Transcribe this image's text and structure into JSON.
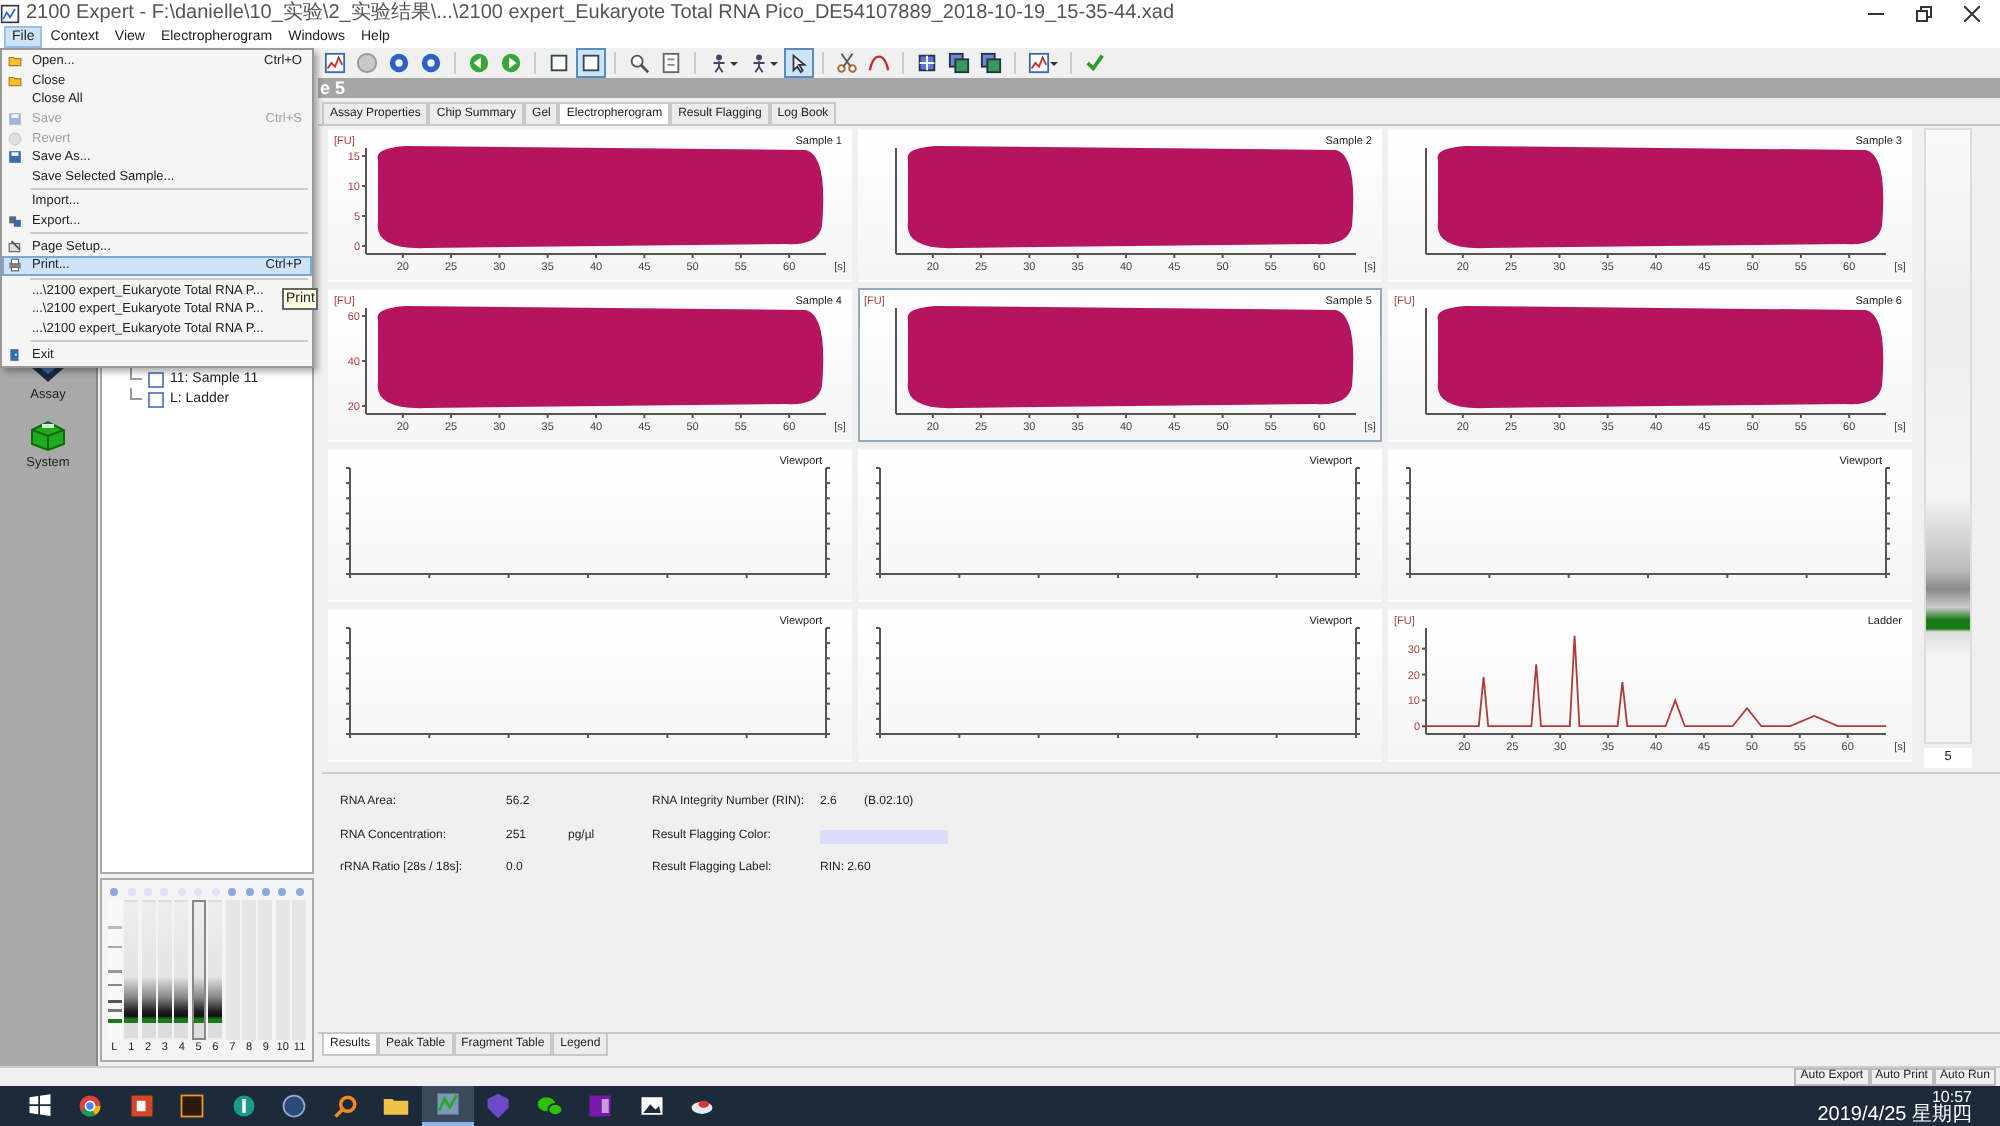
{
  "window": {
    "title": "2100 Expert - F:\\danielle\\10_实验\\2_实验结果\\...\\2100 expert_Eukaryote Total RNA Pico_DE54107889_2018-10-19_15-35-44.xad"
  },
  "menu_bar": [
    {
      "label": "File",
      "selected": true
    },
    {
      "label": "Context",
      "selected": false
    },
    {
      "label": "View",
      "selected": false
    },
    {
      "label": "Electropherogram",
      "selected": false
    },
    {
      "label": "Windows",
      "selected": false
    },
    {
      "label": "Help",
      "selected": false
    }
  ],
  "file_menu": {
    "items": [
      {
        "kind": "item",
        "label": "Open...",
        "shortcut": "Ctrl+O",
        "disabled": false,
        "selected": false
      },
      {
        "kind": "item",
        "label": "Close",
        "disabled": false,
        "selected": false
      },
      {
        "kind": "item",
        "label": "Close All",
        "disabled": false,
        "selected": false
      },
      {
        "kind": "item",
        "label": "Save",
        "shortcut": "Ctrl+S",
        "disabled": true,
        "selected": false
      },
      {
        "kind": "item",
        "label": "Revert",
        "disabled": true,
        "selected": false
      },
      {
        "kind": "item",
        "label": "Save As...",
        "disabled": false,
        "selected": false
      },
      {
        "kind": "item",
        "label": "Save Selected Sample...",
        "disabled": false,
        "selected": false
      },
      {
        "kind": "separator"
      },
      {
        "kind": "item",
        "label": "Import...",
        "disabled": false,
        "selected": false
      },
      {
        "kind": "item",
        "label": "Export...",
        "disabled": false,
        "selected": false
      },
      {
        "kind": "separator"
      },
      {
        "kind": "item",
        "label": "Page Setup...",
        "disabled": false,
        "selected": false
      },
      {
        "kind": "item",
        "label": "Print...",
        "shortcut": "Ctrl+P",
        "disabled": false,
        "selected": true
      },
      {
        "kind": "separator"
      },
      {
        "kind": "item",
        "label": "...\\2100 expert_Eukaryote Total RNA P...",
        "disabled": false,
        "selected": false
      },
      {
        "kind": "item",
        "label": "...\\2100 expert_Eukaryote Total RNA P...",
        "disabled": false,
        "selected": false
      },
      {
        "kind": "item",
        "label": "...\\2100 expert_Eukaryote Total RNA P...",
        "disabled": false,
        "selected": false
      },
      {
        "kind": "separator"
      },
      {
        "kind": "item",
        "label": "Exit",
        "disabled": false,
        "selected": false
      }
    ],
    "tooltip": "Print"
  },
  "toolbar": [
    {
      "kind": "chart",
      "selected": false
    },
    {
      "kind": "graydisc",
      "selected": false
    },
    {
      "kind": "bluedisc",
      "selected": false
    },
    {
      "kind": "bluedisc",
      "selected": false
    },
    {
      "kind": "back",
      "selected": false
    },
    {
      "kind": "forward",
      "selected": false
    },
    {
      "kind": "frame",
      "selected": false
    },
    {
      "kind": "frame",
      "selected": true
    },
    {
      "kind": "magnifier",
      "selected": false
    },
    {
      "kind": "page",
      "selected": false
    },
    {
      "kind": "figure",
      "selected": false,
      "caret": true
    },
    {
      "kind": "figure",
      "selected": false,
      "caret": true
    },
    {
      "kind": "pointer",
      "selected": true
    },
    {
      "kind": "scissors",
      "selected": false
    },
    {
      "kind": "curve",
      "selected": false
    },
    {
      "kind": "grid",
      "selected": false
    },
    {
      "kind": "image",
      "selected": false
    },
    {
      "kind": "image",
      "selected": false
    },
    {
      "kind": "chart",
      "selected": false,
      "caret": true
    },
    {
      "kind": "check",
      "selected": false
    }
  ],
  "nav": [
    {
      "label": "Assay",
      "kind": "assay"
    },
    {
      "label": "System",
      "kind": "system"
    }
  ],
  "tree": [
    {
      "label": "11: Sample 11",
      "checked": false
    },
    {
      "label": "L: Ladder",
      "checked": false
    }
  ],
  "gel": {
    "lanes": [
      {
        "label": "L",
        "kind": "ladder",
        "selected": false
      },
      {
        "label": "1",
        "kind": "sample",
        "selected": false
      },
      {
        "label": "2",
        "kind": "sample",
        "selected": false
      },
      {
        "label": "3",
        "kind": "sample",
        "selected": false
      },
      {
        "label": "4",
        "kind": "sample",
        "selected": false
      },
      {
        "label": "5",
        "kind": "sample",
        "selected": true
      },
      {
        "label": "6",
        "kind": "sample",
        "selected": false
      },
      {
        "label": "7",
        "kind": "empty",
        "selected": false
      },
      {
        "label": "8",
        "kind": "empty",
        "selected": false
      },
      {
        "label": "9",
        "kind": "empty",
        "selected": false
      },
      {
        "label": "10",
        "kind": "empty",
        "selected": false
      },
      {
        "label": "11",
        "kind": "empty",
        "selected": false
      }
    ]
  },
  "header": "e 5",
  "tabs": [
    {
      "label": "Assay Properties",
      "selected": false
    },
    {
      "label": "Chip Summary",
      "selected": false
    },
    {
      "label": "Gel",
      "selected": false
    },
    {
      "label": "Electropherogram",
      "selected": true
    },
    {
      "label": "Result Flagging",
      "selected": false
    },
    {
      "label": "Log Book",
      "selected": false
    }
  ],
  "charts": [
    {
      "kind": "sample",
      "title": "Sample 1",
      "selected": false,
      "redacted": true,
      "ylabel": "[FU]",
      "yticks": [
        "15",
        "10",
        "5",
        "0"
      ],
      "xticks": [
        "20",
        "25",
        "30",
        "35",
        "40",
        "45",
        "50",
        "55",
        "60"
      ],
      "xunit": "[s]"
    },
    {
      "kind": "sample",
      "title": "Sample 2",
      "selected": false,
      "redacted": true,
      "xticks": [
        "20",
        "25",
        "30",
        "35",
        "40",
        "45",
        "50",
        "55",
        "60"
      ],
      "xunit": "[s]"
    },
    {
      "kind": "sample",
      "title": "Sample 3",
      "selected": false,
      "redacted": true,
      "xticks": [
        "20",
        "25",
        "30",
        "35",
        "40",
        "45",
        "50",
        "55",
        "60"
      ],
      "xunit": "[s]"
    },
    {
      "kind": "sample",
      "title": "Sample 4",
      "selected": false,
      "redacted": true,
      "ylabel": "[FU]",
      "yticks": [
        "60",
        "40",
        "20"
      ],
      "xticks": [
        "20",
        "25",
        "30",
        "35",
        "40",
        "45",
        "50",
        "55",
        "60"
      ],
      "xunit": "[s]"
    },
    {
      "kind": "sample",
      "title": "Sample 5",
      "selected": true,
      "redacted": true,
      "ylabel": "[FU]",
      "xticks": [
        "20",
        "25",
        "30",
        "35",
        "40",
        "45",
        "50",
        "55",
        "60"
      ],
      "xunit": "[s]"
    },
    {
      "kind": "sample",
      "title": "Sample 6",
      "selected": false,
      "redacted": true,
      "ylabel": "[FU]",
      "xticks": [
        "20",
        "25",
        "30",
        "35",
        "40",
        "45",
        "50",
        "55",
        "60"
      ],
      "xunit": "[s]"
    },
    {
      "kind": "viewport",
      "title": "Viewport",
      "selected": false
    },
    {
      "kind": "viewport",
      "title": "Viewport",
      "selected": false
    },
    {
      "kind": "viewport",
      "title": "Viewport",
      "selected": false
    },
    {
      "kind": "viewport",
      "title": "Viewport",
      "selected": false
    },
    {
      "kind": "viewport",
      "title": "Viewport",
      "selected": false
    },
    {
      "kind": "ladder",
      "selected": false,
      "chart_data": {
        "type": "line",
        "ylabel": "[FU]",
        "xlabel": "[s]",
        "xlim": [
          16,
          64
        ],
        "ylim": [
          -3,
          38
        ],
        "xticks": [
          20,
          25,
          30,
          35,
          40,
          45,
          50,
          55,
          60
        ],
        "yticks": [
          0,
          10,
          20,
          30
        ],
        "x": [
          16,
          21.5,
          22,
          22.5,
          27,
          27.5,
          28,
          31,
          31.5,
          32,
          36,
          36.5,
          37,
          41,
          42,
          43,
          48,
          49.5,
          51,
          54,
          56.5,
          59,
          64
        ],
        "series": [
          {
            "name": "Ladder",
            "color": "#b03a3a",
            "values": [
              0,
              0,
              19,
              0,
              0,
              24,
              0,
              0,
              35,
              0,
              0,
              17,
              0,
              0,
              10,
              0,
              0,
              7,
              0,
              0,
              4,
              0,
              0
            ]
          }
        ]
      }
    }
  ],
  "lane_view": {
    "label": "5"
  },
  "results": {
    "left": [
      {
        "label": "RNA Area:",
        "value": "56.2"
      },
      {
        "label": "RNA Concentration:",
        "value": "251",
        "unit": "pg/µl"
      },
      {
        "label": "rRNA Ratio [28s / 18s]:",
        "value": "0.0"
      }
    ],
    "right": [
      {
        "label": "RNA Integrity Number (RIN):",
        "value": "2.6",
        "note": "(B.02.10)"
      },
      {
        "label": "Result Flagging Color:",
        "color": "#dcdcf8"
      },
      {
        "label": "Result Flagging Label:",
        "value": "RIN: 2.60"
      }
    ]
  },
  "bottom_tabs": [
    {
      "label": "Results",
      "selected": true
    },
    {
      "label": "Peak Table",
      "selected": false
    },
    {
      "label": "Fragment Table",
      "selected": false
    },
    {
      "label": "Legend",
      "selected": false
    }
  ],
  "status_bar": [
    "Auto Export",
    "Auto Print",
    "Auto Run"
  ],
  "taskbar": {
    "apps": [
      {
        "kind": "start",
        "selected": false
      },
      {
        "kind": "ring",
        "selected": false
      },
      {
        "kind": "redtile",
        "selected": false
      },
      {
        "kind": "darktile",
        "selected": false
      },
      {
        "kind": "greendisc",
        "selected": false
      },
      {
        "kind": "bluering",
        "selected": false
      },
      {
        "kind": "search",
        "selected": false
      },
      {
        "kind": "folder",
        "selected": false
      },
      {
        "kind": "app",
        "selected": true
      },
      {
        "kind": "shield",
        "selected": false
      },
      {
        "kind": "chat",
        "selected": false
      },
      {
        "kind": "note",
        "selected": false
      },
      {
        "kind": "photo",
        "selected": false
      },
      {
        "kind": "cloud",
        "selected": false
      }
    ],
    "time": "10:57",
    "date": "2019/4/25 星期四"
  }
}
